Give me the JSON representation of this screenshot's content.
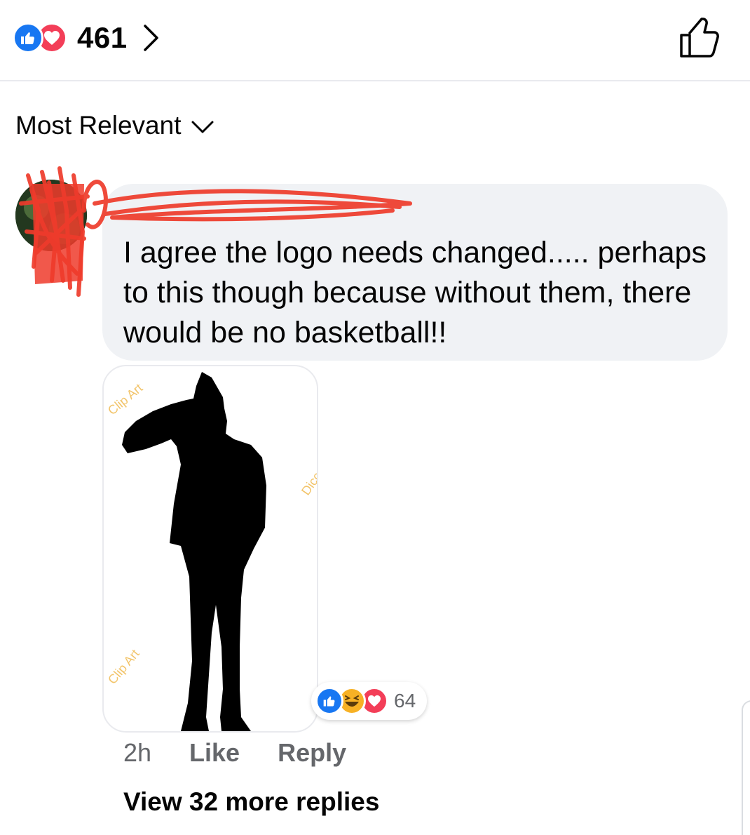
{
  "header": {
    "reaction_count": "461",
    "reactions": [
      "like-icon",
      "love-icon"
    ],
    "like_icon": "thumbs-up-outline-icon"
  },
  "sort": {
    "label": "Most Relevant"
  },
  "comment": {
    "author": "",
    "text": "I agree the logo needs changed..... perhaps to this though because without them, there would be no basketball!!",
    "attachment": {
      "watermarks": [
        "Clip Art",
        "Dicc",
        "Clip Art"
      ]
    },
    "reactions": {
      "icons": [
        "like-icon",
        "haha-icon",
        "love-icon"
      ],
      "count": "64"
    },
    "time": "2h",
    "like_label": "Like",
    "reply_label": "Reply",
    "view_more": "View 32 more replies"
  },
  "colors": {
    "like_blue": "#1877f2",
    "love_red": "#f33e58",
    "haha_yellow": "#f7b125",
    "bubble_gray": "#f0f2f5",
    "meta_gray": "#65676b",
    "redaction_red": "#ee3b2b"
  }
}
